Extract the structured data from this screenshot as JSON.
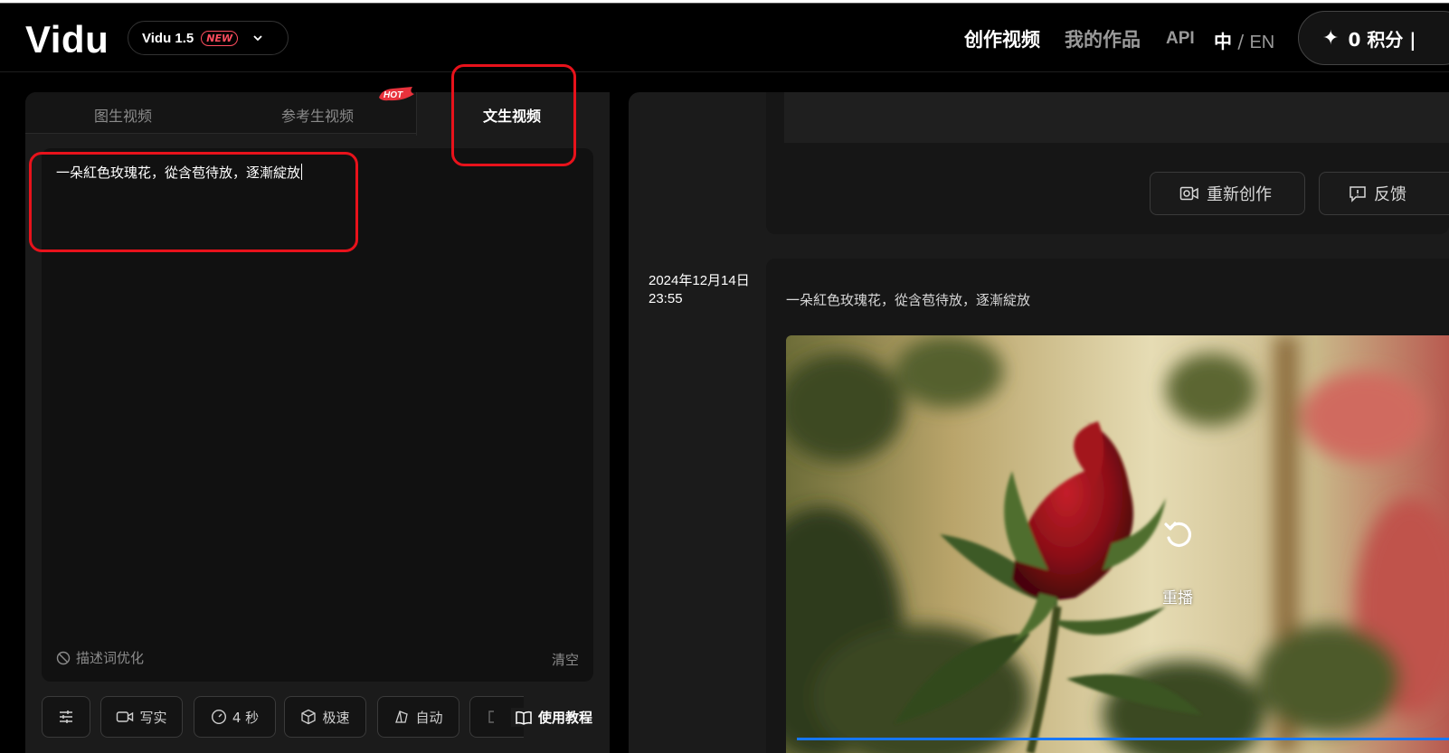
{
  "header": {
    "logo": "Vidu",
    "version_label": "Vidu 1.5",
    "version_badge": "NEW",
    "nav_create": "创作视频",
    "nav_works": "我的作品",
    "nav_api": "API",
    "lang_zh": "中",
    "lang_sep": "/",
    "lang_en": "EN",
    "credits": "0 积分 |"
  },
  "tabs": {
    "image_to_video": "图生视频",
    "reference_to_video": "参考生视频",
    "text_to_video": "文生视频",
    "hot_badge": "HOT"
  },
  "prompt": {
    "value": "一朵紅色玫瑰花，從含苞待放，逐漸綻放",
    "optimize_label": "描述词优化",
    "clear_label": "清空"
  },
  "toolbar": {
    "style": "写实",
    "duration": "4 秒",
    "speed": "极速",
    "aspect": "自动",
    "tutorial": "使用教程"
  },
  "previous_card": {
    "recreate_label": "重新创作",
    "feedback_label": "反馈"
  },
  "result": {
    "date": "2024年12月14日",
    "time": "23:55",
    "prompt": "一朵紅色玫瑰花，從含苞待放，逐漸綻放",
    "replay_label": "重播",
    "progress": 1.0
  },
  "colors": {
    "background": "#000000",
    "panel": "#1b1b1b",
    "accent_blue": "#1677ff",
    "badge_red": "#ff4d5e",
    "annotation_red": "#e8121b"
  }
}
